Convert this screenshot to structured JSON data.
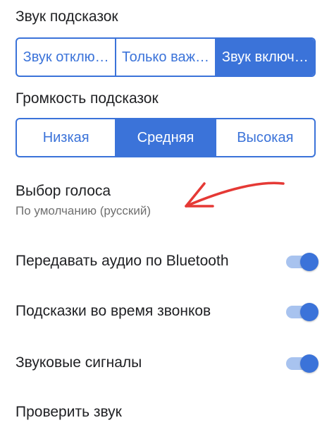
{
  "hint_sound": {
    "title": "Звук подсказок",
    "options": [
      "Звук отклю…",
      "Только важ…",
      "Звук включ…"
    ],
    "selected": "Звук включ…"
  },
  "hint_volume": {
    "title": "Громкость подсказок",
    "options": [
      "Низкая",
      "Средняя",
      "Высокая"
    ],
    "selected": "Средняя"
  },
  "voice": {
    "title": "Выбор голоса",
    "value": "По умолчанию (русский)"
  },
  "toggles": [
    {
      "label": "Передавать аудио по Bluetooth",
      "on": true
    },
    {
      "label": "Подсказки во время звонков",
      "on": true
    },
    {
      "label": "Звуковые сигналы",
      "on": true
    }
  ],
  "check_sound": {
    "label": "Проверить звук"
  },
  "colors": {
    "accent": "#3b73d9",
    "toggle_track": "#a8c3ef",
    "annotation_arrow": "#e53935"
  }
}
